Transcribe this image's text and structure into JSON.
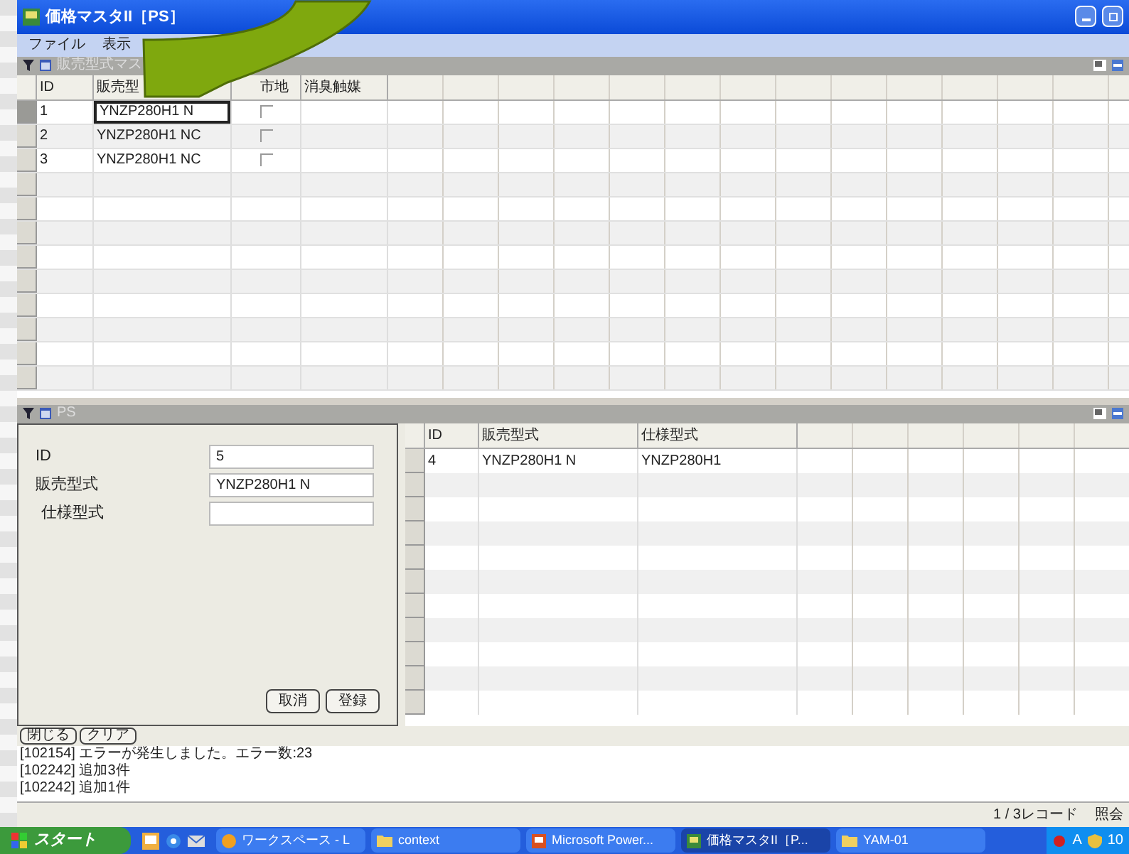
{
  "window": {
    "title": "価格マスタII［PS］"
  },
  "menu": [
    "ファイル",
    "表示"
  ],
  "upper_panel": {
    "title": "販売型式マス",
    "columns": [
      "ID",
      "販売型",
      "市地",
      "消臭触媒"
    ],
    "rows": [
      {
        "id": "1",
        "model": "YNZP280H1 N",
        "checked": false,
        "selected": true
      },
      {
        "id": "2",
        "model": "YNZP280H1 NC",
        "checked": false,
        "selected": false
      },
      {
        "id": "3",
        "model": "YNZP280H1 NC",
        "checked": false,
        "selected": false
      }
    ]
  },
  "lower_panel": {
    "title": "PS",
    "form": [
      {
        "label": "ID",
        "value": "5"
      },
      {
        "label": "販売型式",
        "value": "YNZP280H1 N"
      },
      {
        "label": "仕様型式"
      }
    ],
    "form_buttons": [
      "取消",
      "登録"
    ],
    "columns": [
      "ID",
      "販売型式",
      "仕様型式"
    ],
    "rows": [
      [
        "4",
        "YNZP280H1 N",
        "YNZP280H1"
      ]
    ]
  },
  "footer_buttons": [
    "閉じる",
    "クリア"
  ],
  "log": [
    "[102154] エラーが発生しました。エラー数:23",
    "[102242] 追加3件",
    "[102242] 追加1件"
  ],
  "status_bar": {
    "records": "1 / 3レコード",
    "mode": "照会"
  },
  "taskbar": {
    "start": "スタート",
    "items": [
      {
        "label": "ワークスペース - L",
        "kind": "app",
        "selected": false
      },
      {
        "label": "context",
        "kind": "folder",
        "selected": false
      },
      {
        "label": "Microsoft Power...",
        "kind": "ppt",
        "selected": false
      },
      {
        "label": "価格マスタII［P...",
        "kind": "window",
        "selected": true
      },
      {
        "label": "YAM-01",
        "kind": "folder",
        "selected": false
      }
    ],
    "ime": "A",
    "clock": "10"
  }
}
